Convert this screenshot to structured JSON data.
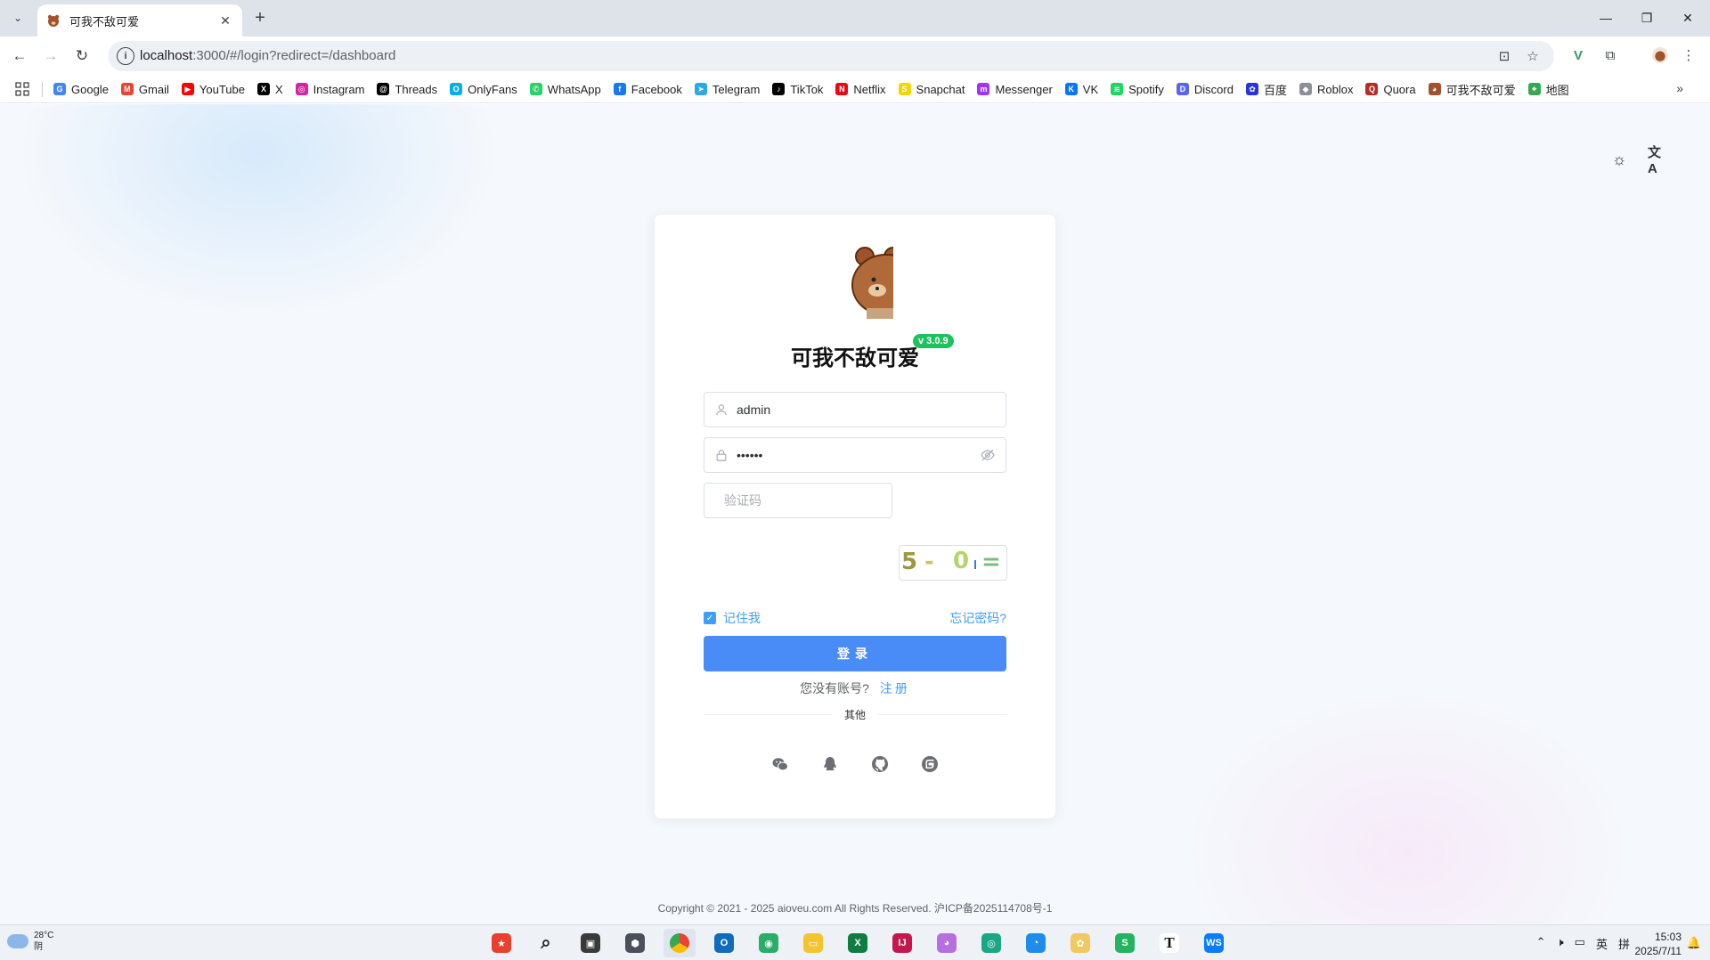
{
  "browser": {
    "tab_title": "可我不敌可爱",
    "url_host": "localhost",
    "url_rest": ":3000/#/login?redirect=/dashboard"
  },
  "bookmarks": [
    {
      "label": "Google",
      "icon": "google-icon",
      "color": "#4285f4",
      "glyph": "G"
    },
    {
      "label": "Gmail",
      "icon": "gmail-icon",
      "color": "#ea4335",
      "glyph": "M"
    },
    {
      "label": "YouTube",
      "icon": "youtube-icon",
      "color": "#ff0000",
      "glyph": "▶"
    },
    {
      "label": "X",
      "icon": "x-icon",
      "color": "#000000",
      "glyph": "X"
    },
    {
      "label": "Instagram",
      "icon": "instagram-icon",
      "color": "#d6249f",
      "glyph": "◎"
    },
    {
      "label": "Threads",
      "icon": "threads-icon",
      "color": "#000000",
      "glyph": "@"
    },
    {
      "label": "OnlyFans",
      "icon": "onlyfans-icon",
      "color": "#00aff0",
      "glyph": "O"
    },
    {
      "label": "WhatsApp",
      "icon": "whatsapp-icon",
      "color": "#25d366",
      "glyph": "✆"
    },
    {
      "label": "Facebook",
      "icon": "facebook-icon",
      "color": "#1877f2",
      "glyph": "f"
    },
    {
      "label": "Telegram",
      "icon": "telegram-icon",
      "color": "#29a9eb",
      "glyph": "➤"
    },
    {
      "label": "TikTok",
      "icon": "tiktok-icon",
      "color": "#000000",
      "glyph": "♪"
    },
    {
      "label": "Netflix",
      "icon": "netflix-icon",
      "color": "#e50914",
      "glyph": "N"
    },
    {
      "label": "Snapchat",
      "icon": "snapchat-icon",
      "color": "#f7d600",
      "glyph": "S"
    },
    {
      "label": "Messenger",
      "icon": "messenger-icon",
      "color": "#a033ff",
      "glyph": "m"
    },
    {
      "label": "VK",
      "icon": "vk-icon",
      "color": "#0077ff",
      "glyph": "K"
    },
    {
      "label": "Spotify",
      "icon": "spotify-icon",
      "color": "#1ed760",
      "glyph": "≋"
    },
    {
      "label": "Discord",
      "icon": "discord-icon",
      "color": "#5865f2",
      "glyph": "D"
    },
    {
      "label": "百度",
      "icon": "baidu-icon",
      "color": "#2932e1",
      "glyph": "✿"
    },
    {
      "label": "Roblox",
      "icon": "roblox-icon",
      "color": "#8a8f98",
      "glyph": "◆"
    },
    {
      "label": "Quora",
      "icon": "quora-icon",
      "color": "#b92b27",
      "glyph": "Q"
    },
    {
      "label": "可我不敌可爱",
      "icon": "bear-favicon-icon",
      "color": "#a0522d",
      "glyph": "◕"
    },
    {
      "label": "地图",
      "icon": "maps-icon",
      "color": "#34a853",
      "glyph": "⌖"
    }
  ],
  "page": {
    "brand": "可我不敌可爱",
    "version": "v 3.0.9",
    "heading": "登录",
    "username_value": "admin",
    "password_value": "••••••",
    "captcha_placeholder": "验证码",
    "captcha_text": [
      "5",
      "-",
      "0",
      "="
    ],
    "remember_label": "记住我",
    "forgot_label": "忘记密码?",
    "login_label": "登录",
    "no_account": "您没有账号?",
    "register_label": "注册",
    "other_label": "其他",
    "socials": [
      "wechat-icon",
      "qq-icon",
      "github-icon",
      "gitee-icon"
    ],
    "copyright": "Copyright © 2021 - 2025 aioveu.com All Rights Reserved. 沪ICP备2025114708号-1"
  },
  "taskbar": {
    "temperature": "28°C",
    "weather": "阴",
    "ime_lang": "英",
    "ime_mode": "拼",
    "time": "15:03",
    "date": "2025/7/11"
  },
  "colors": {
    "primary": "#409eff",
    "login_button": "#4a8cf7",
    "version_badge": "#1fc15e"
  }
}
